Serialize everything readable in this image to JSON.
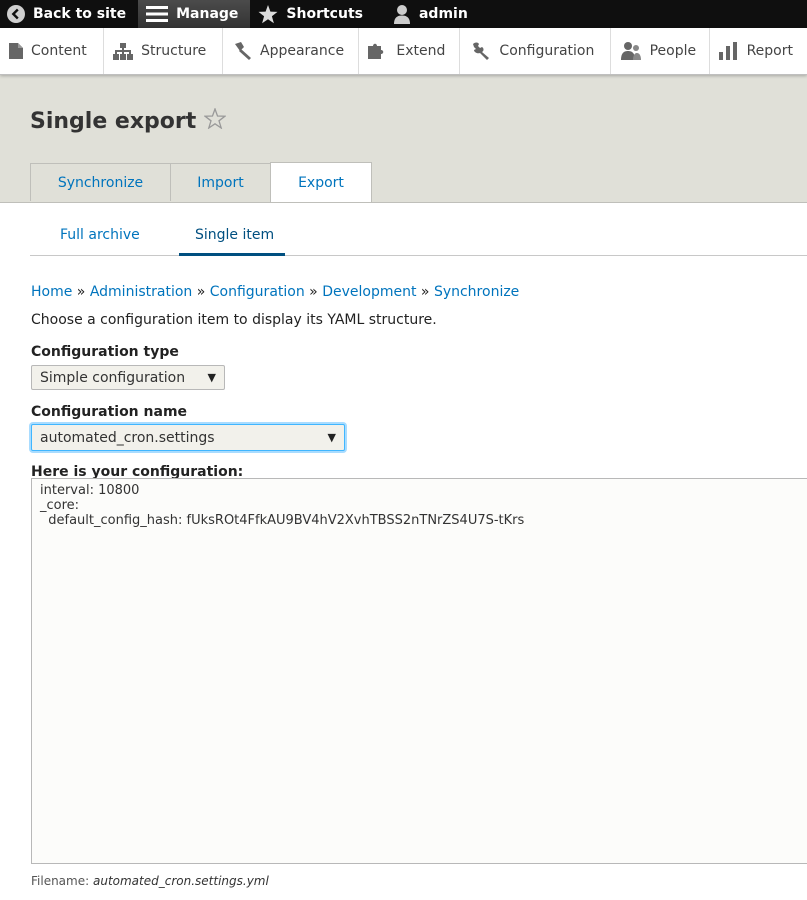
{
  "toolbar": {
    "back_label": "Back to site",
    "manage_label": "Manage",
    "shortcuts_label": "Shortcuts",
    "user_label": "admin"
  },
  "tray": {
    "items": [
      {
        "label": "Content",
        "icon": "file-icon"
      },
      {
        "label": "Structure",
        "icon": "sitemap-icon"
      },
      {
        "label": "Appearance",
        "icon": "paintbrush-icon"
      },
      {
        "label": "Extend",
        "icon": "puzzle-icon"
      },
      {
        "label": "Configuration",
        "icon": "wrench-icon"
      },
      {
        "label": "People",
        "icon": "people-icon"
      },
      {
        "label": "Report",
        "icon": "bar-chart-icon"
      }
    ]
  },
  "page": {
    "title": "Single export",
    "tabs": [
      "Synchronize",
      "Import",
      "Export"
    ],
    "active_tab": "Export",
    "subtabs": [
      "Full archive",
      "Single item"
    ],
    "active_subtab": "Single item"
  },
  "breadcrumb": [
    "Home",
    "Administration",
    "Configuration",
    "Development",
    "Synchronize"
  ],
  "breadcrumb_separator": "»",
  "help_text": "Choose a configuration item to display its YAML structure.",
  "config_type": {
    "label": "Configuration type",
    "value": "Simple configuration"
  },
  "config_name": {
    "label": "Configuration name",
    "value": "automated_cron.settings"
  },
  "export": {
    "label": "Here is your configuration:",
    "yaml": "interval: 10800\n_core:\n  default_config_hash: fUksROt4FfkAU9BV4hV2XvhTBSS2nTNrZS4U7S-tKrs"
  },
  "filename": {
    "prefix": "Filename:",
    "value": "automated_cron.settings.yml"
  },
  "colors": {
    "link": "#0074bd",
    "toolbar_bg": "#0f0f0f",
    "header_bg": "#e0e0d8",
    "focus": "#40b6ff"
  }
}
